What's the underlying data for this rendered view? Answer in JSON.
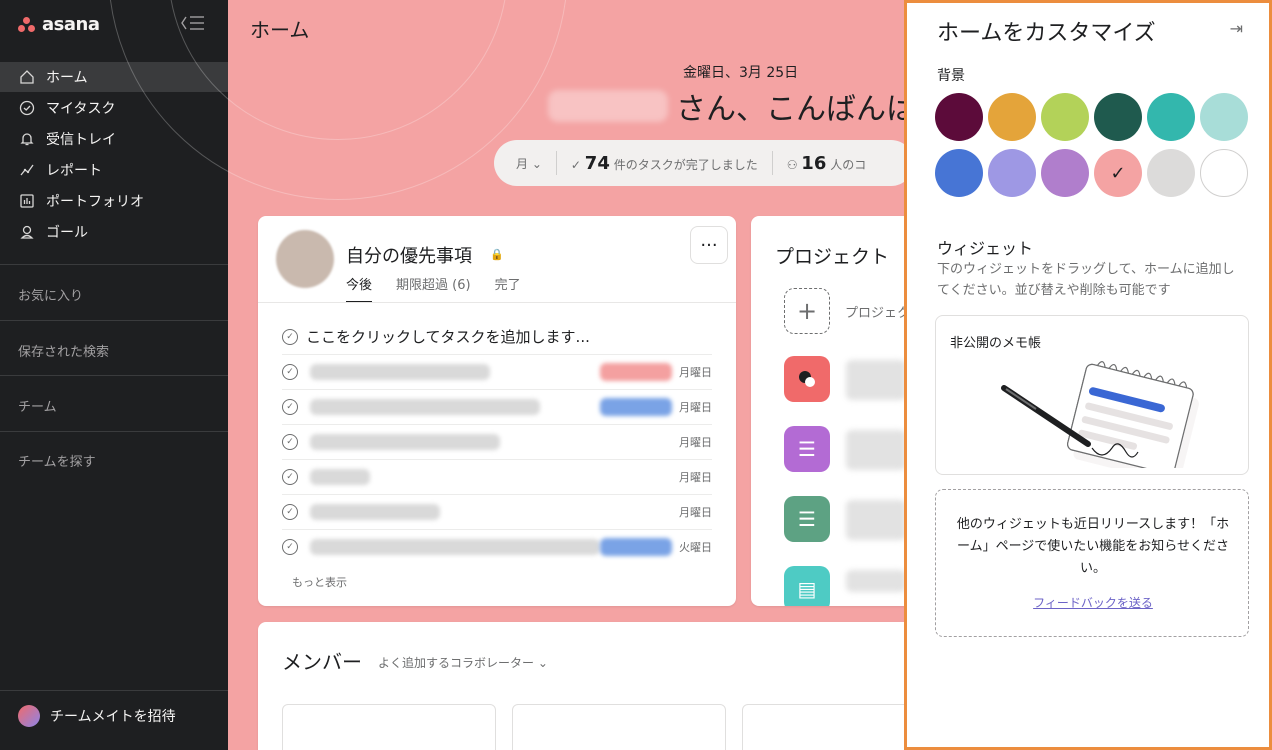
{
  "app": {
    "name": "asana"
  },
  "sidebar": {
    "nav": [
      {
        "label": "ホーム",
        "icon": "home-icon"
      },
      {
        "label": "マイタスク",
        "icon": "check-circle-icon"
      },
      {
        "label": "受信トレイ",
        "icon": "bell-icon"
      },
      {
        "label": "レポート",
        "icon": "chart-line-icon"
      },
      {
        "label": "ポートフォリオ",
        "icon": "bar-chart-icon"
      },
      {
        "label": "ゴール",
        "icon": "person-icon"
      }
    ],
    "sections": [
      "お気に入り",
      "保存された検索",
      "チーム",
      "チームを探す"
    ],
    "invite_label": "チームメイトを招待"
  },
  "main": {
    "page_title": "ホーム",
    "date": "金曜日、3月 25日",
    "greeting": "さん、こんばんは",
    "stats": {
      "period": "月",
      "tasks_count": "74",
      "tasks_label": "件のタスクが完了しました",
      "collab_count": "16",
      "collab_label": "人のコ"
    },
    "priority": {
      "title": "自分の優先事項",
      "tabs": [
        "今後",
        "期限超過 (6)",
        "完了"
      ],
      "add_task": "ここをクリックしてタスクを追加します...",
      "rows": [
        {
          "day": "月曜日",
          "tag_color": "#f4a0a0"
        },
        {
          "day": "月曜日",
          "tag_color": "#7aa3e6"
        },
        {
          "day": "月曜日",
          "tag_color": ""
        },
        {
          "day": "月曜日",
          "tag_color": ""
        },
        {
          "day": "月曜日",
          "tag_color": ""
        },
        {
          "day": "火曜日",
          "tag_color": "#7aa3e6"
        }
      ],
      "show_more": "もっと表示"
    },
    "projects": {
      "title": "プロジェクト",
      "new_label": "プロジェクトを作成",
      "items": [
        {
          "icon": "chat-icon",
          "color": "#f06a6a"
        },
        {
          "icon": "list-icon",
          "color": "#b36bd4"
        },
        {
          "icon": "list-icon",
          "color": "#5da283"
        },
        {
          "icon": "presentation-icon",
          "color": "#4ecbc4"
        }
      ]
    },
    "members": {
      "title": "メンバー",
      "subtitle": "よく追加するコラボレーター"
    }
  },
  "panel": {
    "title": "ホームをカスタマイズ",
    "background_label": "背景",
    "swatches": [
      "#5c0b3a",
      "#e4a43a",
      "#b3d259",
      "#1f5a4e",
      "#33b7ad",
      "#a8ddd8",
      "#4775d5",
      "#9e98e4",
      "#b07ecc",
      "#f4a3a3",
      "#dcdbda",
      "#ffffff"
    ],
    "selected_swatch": 9,
    "widgets_title": "ウィジェット",
    "widgets_desc": "下のウィジェットをドラッグして、ホームに追加してください。並び替えや削除も可能です",
    "memo_title": "非公開のメモ帳",
    "soon_text": "他のウィジェットも近日リリースします！「ホーム」ページで使いたい機能をお知らせください。",
    "feedback_link": "フィードバックを送る"
  }
}
